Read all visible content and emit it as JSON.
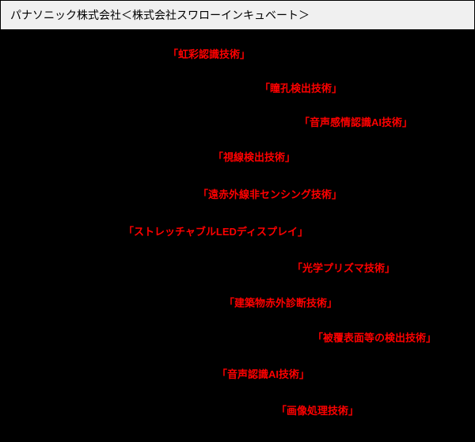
{
  "header": {
    "title": "パナソニック株式会社＜株式会社スワローインキュベート＞"
  },
  "items": [
    {
      "label": "虹彩認識技術"
    },
    {
      "label": "瞳孔検出技術"
    },
    {
      "label": "音声感情認識AI技術"
    },
    {
      "label": "視線検出技術"
    },
    {
      "label": "遠赤外線非センシング技術"
    },
    {
      "label": "ストレッチャブルLEDディスプレイ"
    },
    {
      "label": "光学プリズマ技術"
    },
    {
      "label": "建築物赤外診断技術"
    },
    {
      "label": "被覆表面等の検出技術"
    },
    {
      "label": "音声認識AI技術"
    },
    {
      "label": "画像処理技術"
    }
  ]
}
